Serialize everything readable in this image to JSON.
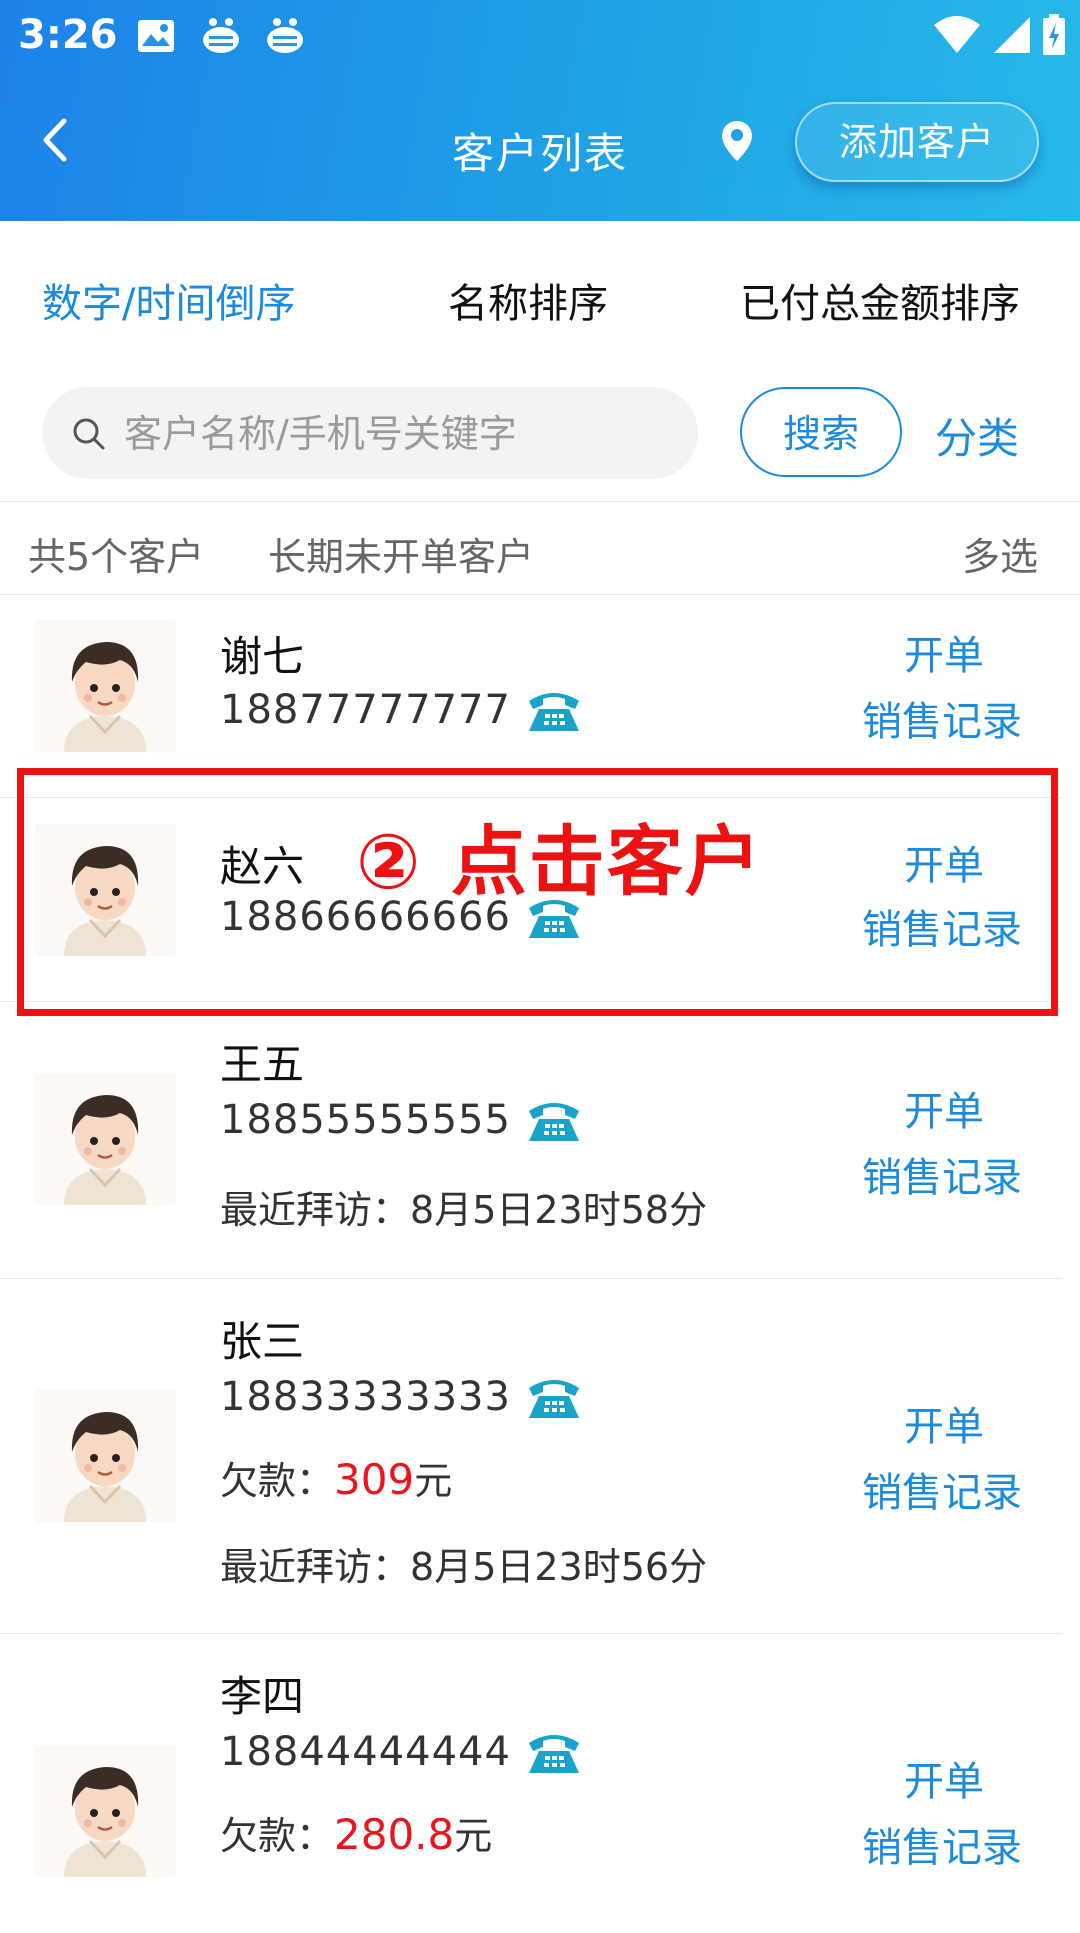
{
  "status_bar": {
    "time": "3:26"
  },
  "navbar": {
    "title": "客户列表",
    "add_button": "添加客户"
  },
  "sort_tabs": [
    {
      "label": "数字/时间倒序",
      "active": true
    },
    {
      "label": "名称排序",
      "active": false
    },
    {
      "label": "已付总金额排序",
      "active": false
    }
  ],
  "search": {
    "placeholder": "客户名称/手机号关键字",
    "value": "",
    "button": "搜索",
    "category": "分类"
  },
  "summary": {
    "count": "共5个客户",
    "long_inactive": "长期未开单客户",
    "multi_select": "多选"
  },
  "action_labels": {
    "open_order": "开单",
    "sales_record": "销售记录"
  },
  "customers": [
    {
      "name": "谢七",
      "phone": "18877777777"
    },
    {
      "name": "赵六",
      "phone": "18866666666"
    },
    {
      "name": "王五",
      "phone": "18855555555",
      "visit_label": "最近拜访：",
      "visit": "8月5日23时58分"
    },
    {
      "name": "张三",
      "phone": "18833333333",
      "debt_label": "欠款：",
      "debt": "309",
      "debt_unit": "元",
      "visit_label": "最近拜访：",
      "visit": "8月5日23时56分"
    },
    {
      "name": "李四",
      "phone": "18844444444",
      "debt_label": "欠款：",
      "debt": "280.8",
      "debt_unit": "元"
    }
  ],
  "annotation": {
    "text": "② 点击客户",
    "color": "#ee1111"
  },
  "colors": {
    "accent": "#1c8bdd",
    "header_start": "#1d82e8",
    "header_end": "#27b9ea",
    "debt": "#e9141c",
    "phone_icon": "#1aa3c8"
  }
}
